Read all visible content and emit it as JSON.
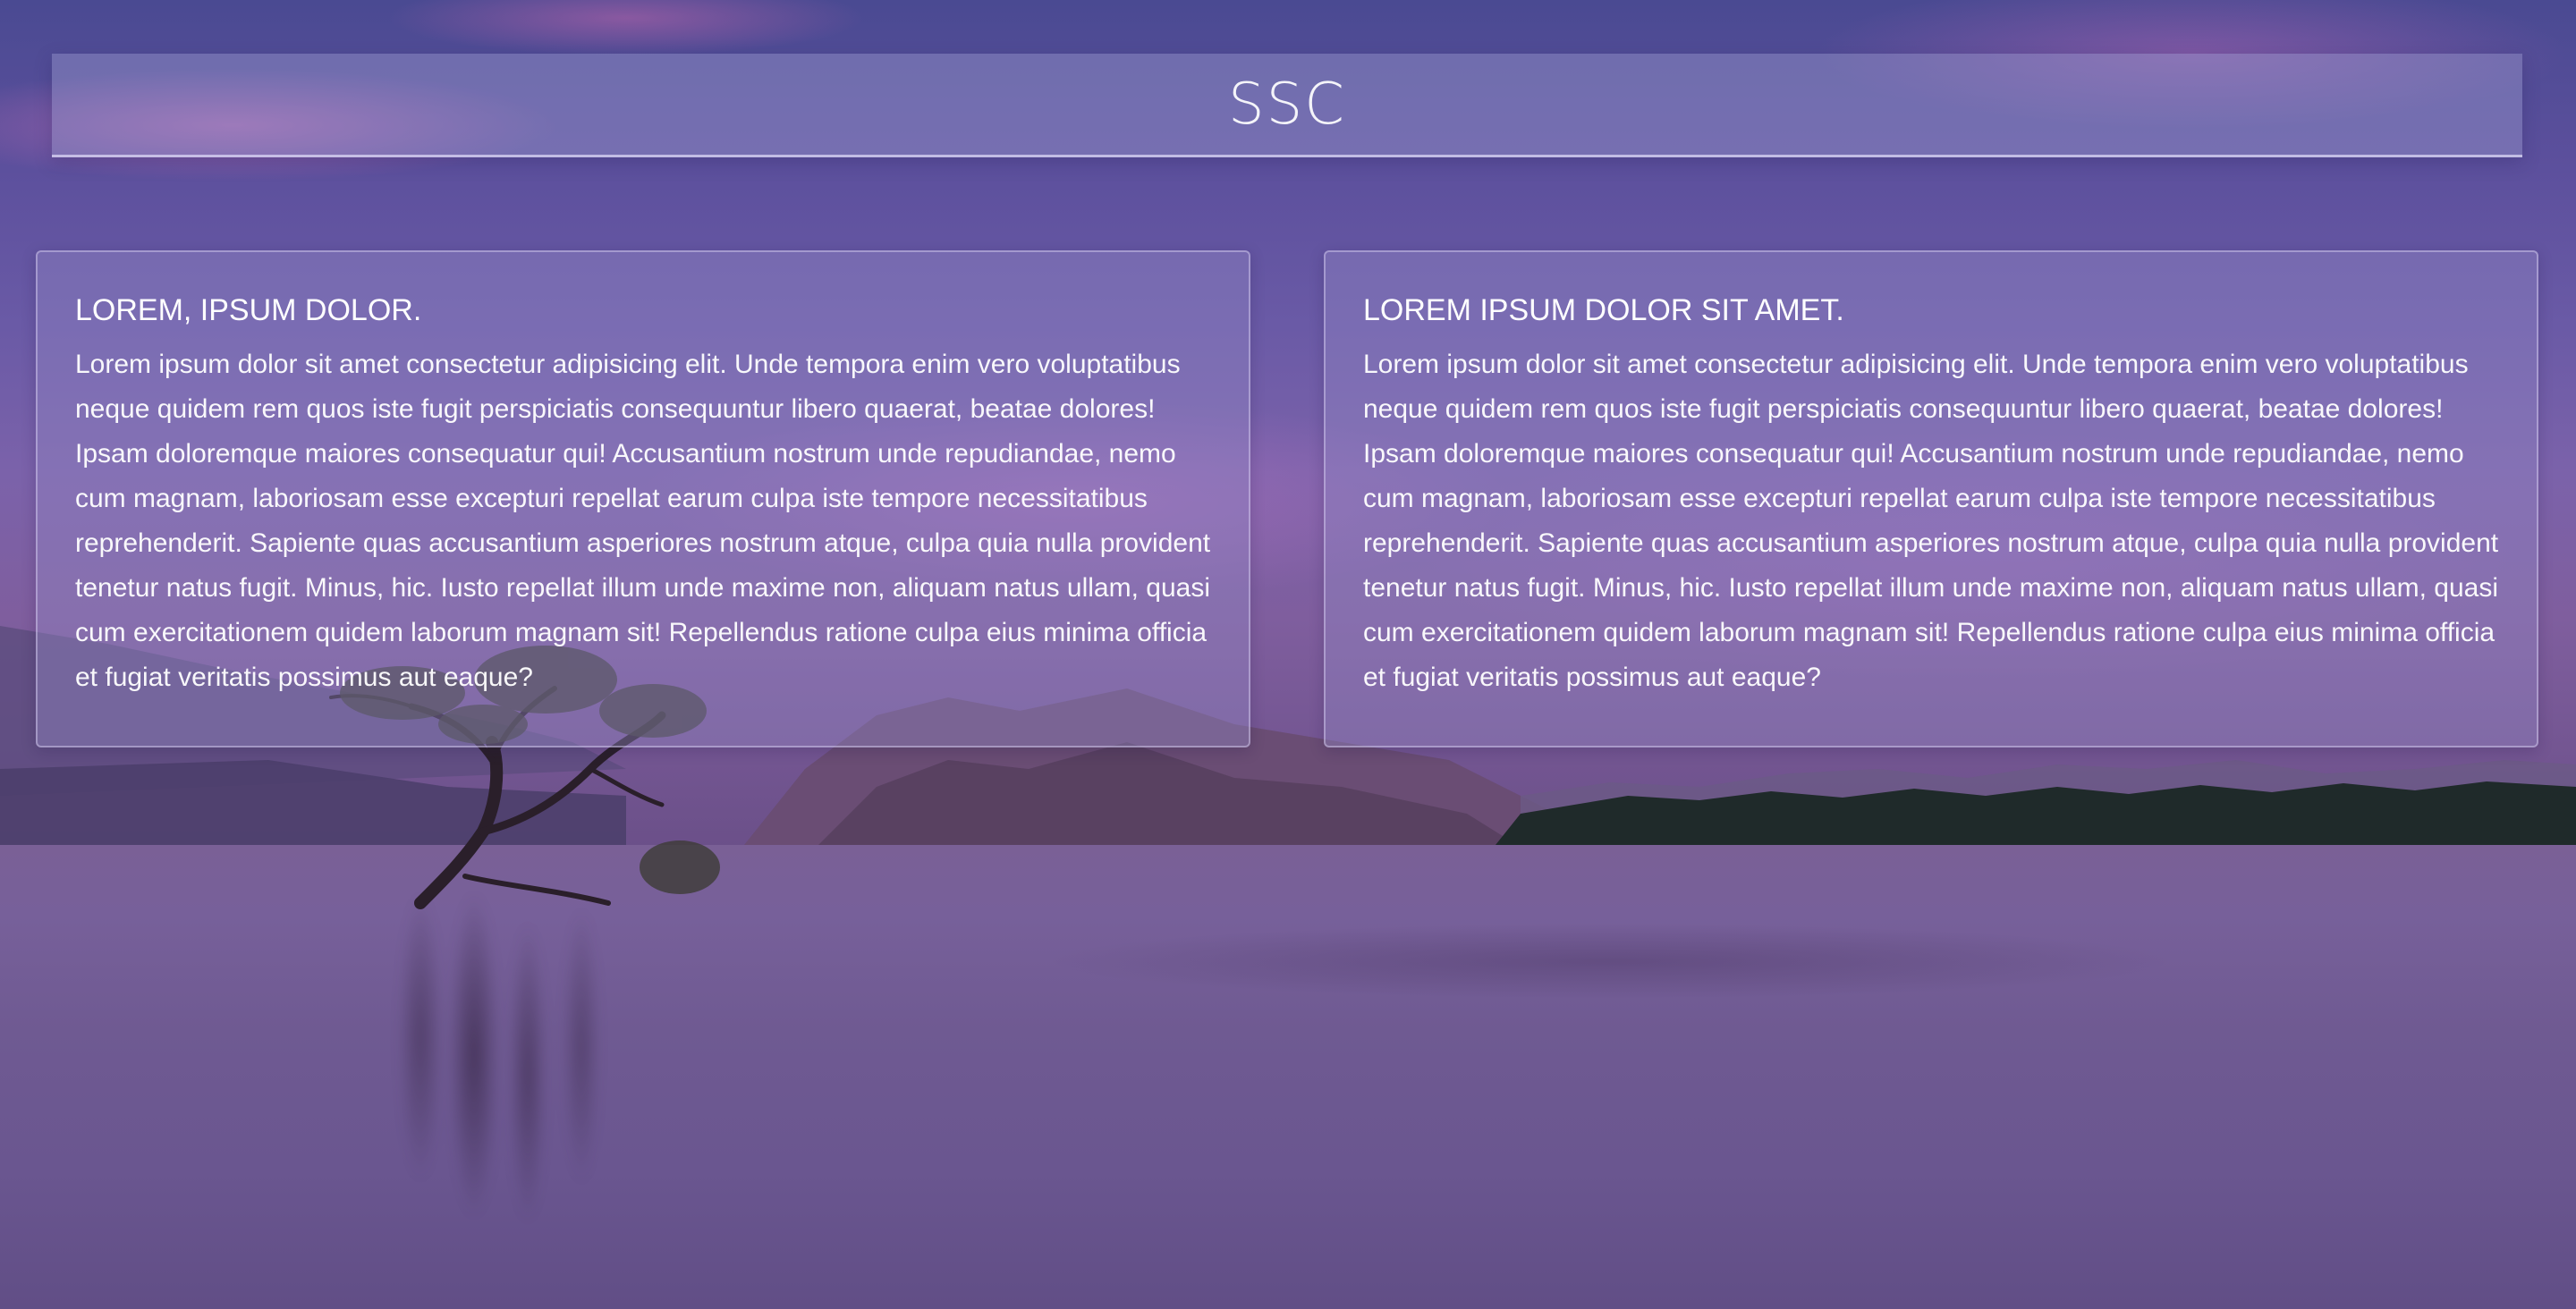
{
  "header": {
    "title": "SSC"
  },
  "cards": [
    {
      "title": "LOREM, IPSUM DOLOR.",
      "body": "Lorem ipsum dolor sit amet consectetur adipisicing elit. Unde tempora enim vero voluptatibus neque quidem rem quos iste fugit perspiciatis consequuntur libero quaerat, beatae dolores! Ipsam doloremque maiores consequatur qui! Accusantium nostrum unde repudiandae, nemo cum magnam, laboriosam esse excepturi repellat earum culpa iste tempore necessitatibus reprehenderit. Sapiente quas accusantium asperiores nostrum atque, culpa quia nulla provident tenetur natus fugit. Minus, hic. Iusto repellat illum unde maxime non, aliquam natus ullam, quasi cum exercitationem quidem laborum magnam sit! Repellendus ratione culpa eius minima officia et fugiat veritatis possimus aut eaque?"
    },
    {
      "title": "LOREM IPSUM DOLOR SIT AMET.",
      "body": "Lorem ipsum dolor sit amet consectetur adipisicing elit. Unde tempora enim vero voluptatibus neque quidem rem quos iste fugit perspiciatis consequuntur libero quaerat, beatae dolores! Ipsam doloremque maiores consequatur qui! Accusantium nostrum unde repudiandae, nemo cum magnam, laboriosam esse excepturi repellat earum culpa iste tempore necessitatibus reprehenderit. Sapiente quas accusantium asperiores nostrum atque, culpa quia nulla provident tenetur natus fugit. Minus, hic. Iusto repellat illum unde maxime non, aliquam natus ullam, quasi cum exercitationem quidem laborum magnam sit! Repellendus ratione culpa eius minima officia et fugiat veritatis possimus aut eaque?"
    }
  ],
  "colors": {
    "sky_top": "#4a4a92",
    "sky_mid": "#7b62aa",
    "water": "#6f5a92",
    "header_bg": "rgba(160,160,210,0.40)",
    "card_bg": "rgba(150,140,200,0.38)",
    "text": "#ffffff"
  }
}
